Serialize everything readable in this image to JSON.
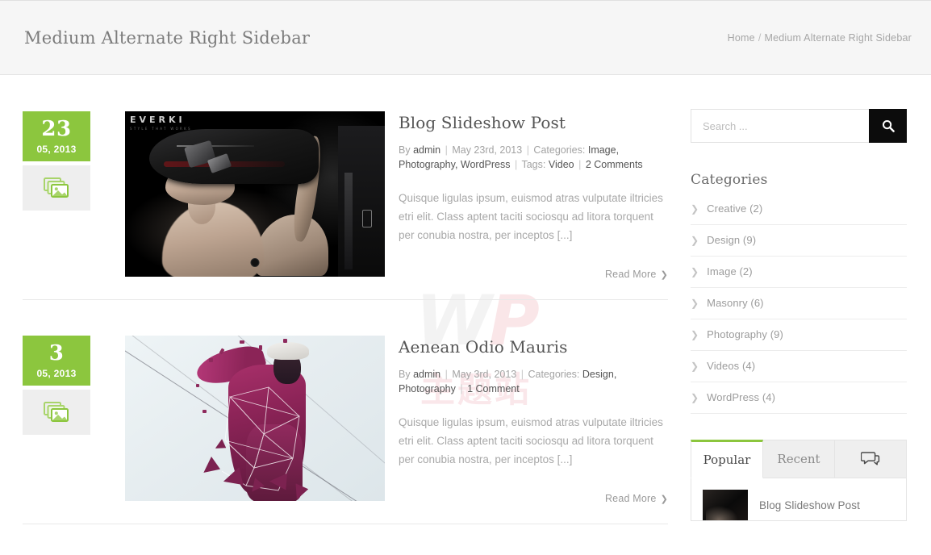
{
  "header": {
    "title": "Medium Alternate Right Sidebar",
    "breadcrumb": {
      "home": "Home",
      "separator": "/",
      "current": "Medium Alternate Right Sidebar"
    }
  },
  "watermark": {
    "wp_w": "W",
    "wp_p": "P",
    "cn": "主题站"
  },
  "posts": [
    {
      "date": {
        "day": "23",
        "month_year": "05, 2013"
      },
      "format_icon": "gallery-icon",
      "title": "Blog Slideshow Post",
      "meta": {
        "by_label": "By",
        "author": "admin",
        "date": "May 23rd, 2013",
        "categories_label": "Categories:",
        "categories": "Image, Photography, WordPress",
        "tags_label": "Tags:",
        "tags": "Video",
        "comments": "2 Comments"
      },
      "excerpt": "Quisque ligulas ipsum, euismod atras vulputate iltricies etri elit. Class aptent taciti sociosqu ad litora torquent per conubia nostra, per inceptos [...]",
      "read_more": "Read More",
      "image_brand": "EVERKI",
      "image_brand_tagline": "STYLE THAT WORKS"
    },
    {
      "date": {
        "day": "3",
        "month_year": "05, 2013"
      },
      "format_icon": "gallery-icon",
      "title": "Aenean Odio Mauris",
      "meta": {
        "by_label": "By",
        "author": "admin",
        "date": "May 3rd, 2013",
        "categories_label": "Categories:",
        "categories": "Design, Photography",
        "tags_label": "",
        "tags": "",
        "comments": "1 Comment"
      },
      "excerpt": "Quisque ligulas ipsum, euismod atras vulputate iltricies etri elit. Class aptent taciti sociosqu ad litora torquent per conubia nostra, per inceptos [...]",
      "read_more": "Read More"
    }
  ],
  "sidebar": {
    "search": {
      "placeholder": "Search ...",
      "value": "",
      "button_icon": "search-icon"
    },
    "categories_widget": {
      "title": "Categories",
      "items": [
        {
          "label": "Creative (2)"
        },
        {
          "label": "Design (9)"
        },
        {
          "label": "Image (2)"
        },
        {
          "label": "Masonry (6)"
        },
        {
          "label": "Photography (9)"
        },
        {
          "label": "Videos (4)"
        },
        {
          "label": "WordPress (4)"
        }
      ]
    },
    "tabs_widget": {
      "tabs": [
        {
          "label": "Popular",
          "active": true
        },
        {
          "label": "Recent",
          "active": false
        },
        {
          "label": "",
          "icon": "comment-bubble-icon",
          "active": false
        }
      ],
      "popular_items": [
        {
          "title": "Blog Slideshow Post"
        }
      ]
    }
  },
  "colors": {
    "accent_green": "#8cc63e",
    "header_bg": "#f6f6f6",
    "text_muted": "#a3a3a3",
    "search_button": "#0c0c0c"
  }
}
